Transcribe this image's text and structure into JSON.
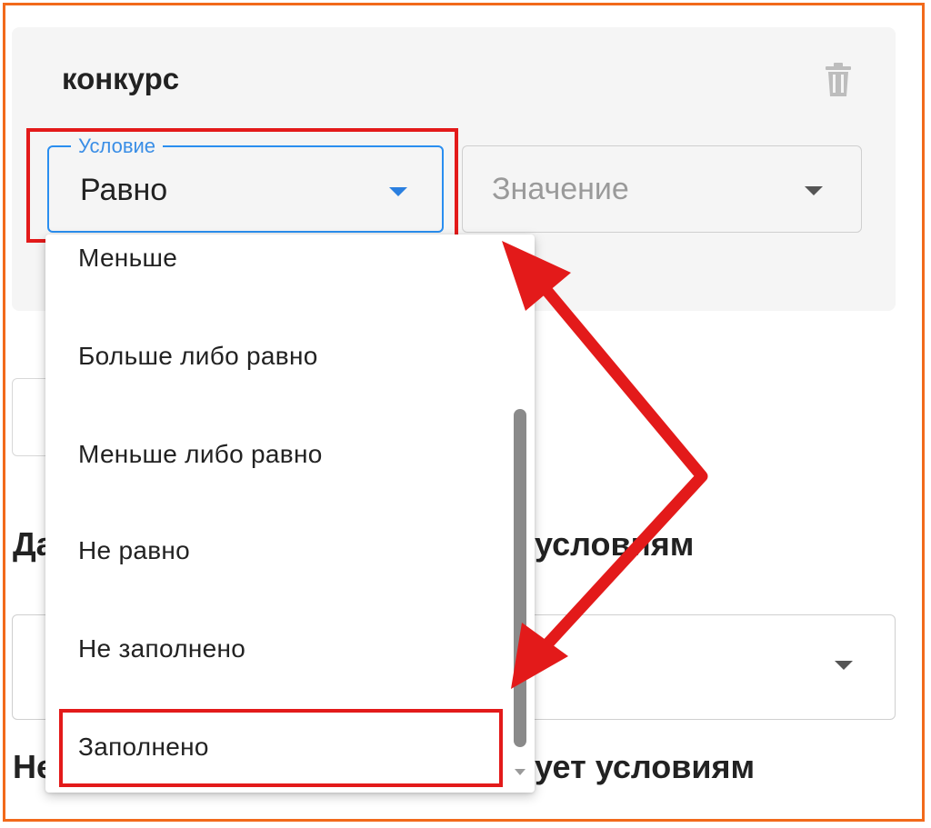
{
  "card": {
    "title": "конкурс",
    "delete_icon": "trash-icon"
  },
  "condition_field": {
    "label": "Условие",
    "value": "Равно",
    "caret_icon": "caret-down-icon"
  },
  "value_field": {
    "placeholder": "Значение",
    "caret_icon": "caret-down-icon"
  },
  "background": {
    "heading_1_start": "Да",
    "heading_1_end": "условиям",
    "heading_2_start": "Не",
    "heading_2_end": "ует условиям"
  },
  "dropdown": {
    "options": [
      "Меньше",
      "Больше либо равно",
      "Меньше либо равно",
      "Не равно",
      "Не заполнено",
      "Заполнено"
    ],
    "highlighted_option_index": 5
  },
  "colors": {
    "frame_border": "#f26a1b",
    "annotation": "#e31a1a",
    "focus_blue": "#2a8ef0",
    "card_bg": "#f5f5f5"
  }
}
